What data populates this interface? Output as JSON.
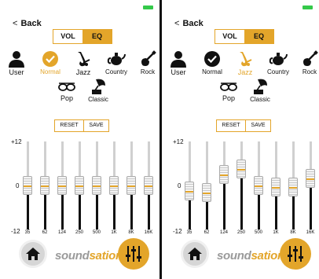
{
  "screens": [
    {
      "name": "normal",
      "back_label": "Back",
      "tab_vol": "VOL",
      "tab_eq": "EQ",
      "selected_preset": "Normal",
      "presets": [
        "User",
        "Normal",
        "Jazz",
        "Country",
        "Rock",
        "Pop",
        "Classic"
      ],
      "reset_label": "RESET",
      "save_label": "SAVE",
      "axis": {
        "max": "+12",
        "zero": "0",
        "min": "-12"
      },
      "bands": [
        "35",
        "62",
        "124",
        "250",
        "500",
        "1K",
        "8K",
        "16K"
      ],
      "gains_db": [
        0,
        0,
        0,
        0,
        0,
        0,
        0,
        0
      ],
      "logo_a": "sound",
      "logo_b": "sation"
    },
    {
      "name": "jazz",
      "back_label": "Back",
      "tab_vol": "VOL",
      "tab_eq": "EQ",
      "selected_preset": "Jazz",
      "presets": [
        "User",
        "Normal",
        "Jazz",
        "Country",
        "Rock",
        "Pop",
        "Classic"
      ],
      "reset_label": "RESET",
      "save_label": "SAVE",
      "axis": {
        "max": "+12",
        "zero": "0",
        "min": "-12"
      },
      "bands": [
        "35",
        "62",
        "124",
        "250",
        "500",
        "1K",
        "8K",
        "16K"
      ],
      "gains_db": [
        -1.5,
        -2,
        3,
        4.5,
        0,
        -0.5,
        -0.5,
        2
      ],
      "logo_a": "sound",
      "logo_b": "sation"
    }
  ],
  "colors": {
    "accent": "#e3a52a",
    "battery": "#35c94a"
  },
  "icons": {
    "back": "chevron-left-icon",
    "user": "person-icon",
    "normal": "checkmark-icon",
    "jazz": "saxophone-icon",
    "country": "teapot-icon",
    "rock": "guitar-icon",
    "pop": "sunglasses-icon",
    "classic": "gramophone-icon",
    "home": "home-icon",
    "eq": "sliders-icon"
  }
}
